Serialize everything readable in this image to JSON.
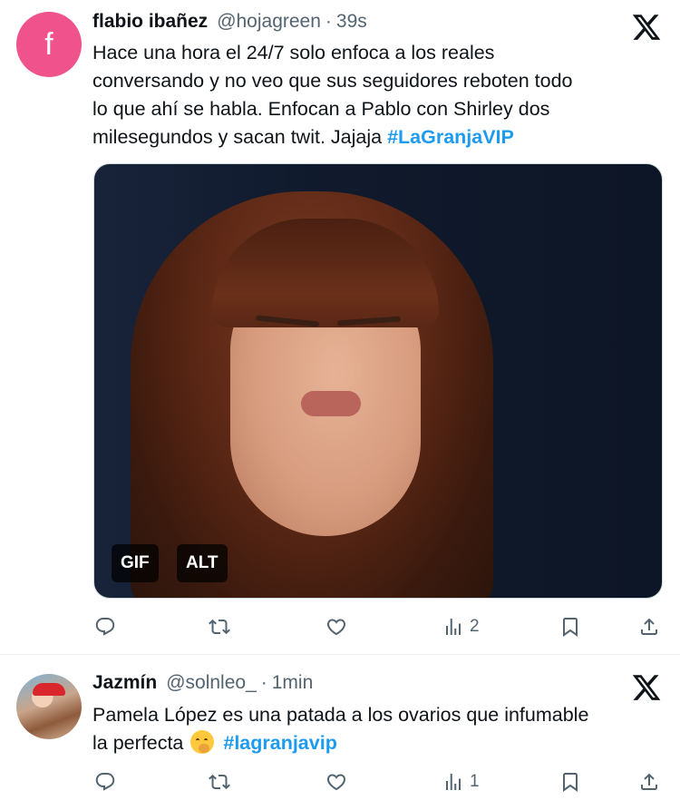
{
  "tweets": [
    {
      "avatar_letter": "f",
      "name": "flabio ibañez",
      "handle": "@hojagreen",
      "separator": "·",
      "time": "39s",
      "text_lines": [
        "Hace una hora el 24/7 solo enfoca a los reales",
        "conversando y no veo que sus seguidores reboten todo",
        "lo que ahí se habla. Enfocan a Pablo con Shirley dos",
        "milesegundos y sacan twit. Jajaja "
      ],
      "hashtag": "#LaGranjaVIP",
      "media": {
        "gif_label": "GIF",
        "alt_label": "ALT"
      },
      "views": "2"
    },
    {
      "name": "Jazmín",
      "handle": "@solnleo_",
      "separator": "·",
      "time": "1min",
      "text_lines": [
        "Pamela López es una patada a los ovarios que infumable",
        "la perfecta "
      ],
      "emoji": "yawning-face",
      "hashtag": "#lagranjavip",
      "views": "1"
    }
  ],
  "colors": {
    "accent": "#1d9bf0",
    "secondary_text": "#536471",
    "avatar_bg": "#f0528c"
  }
}
